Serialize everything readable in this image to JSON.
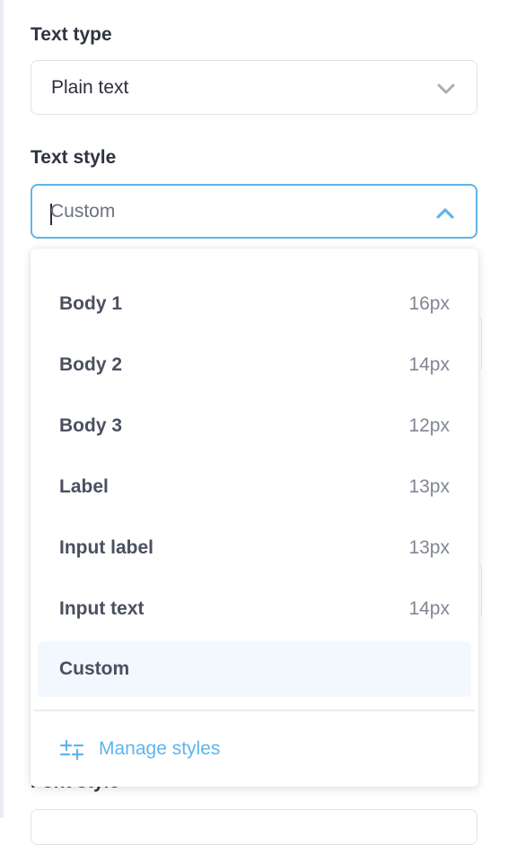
{
  "text_type": {
    "label": "Text type",
    "value": "Plain text",
    "chevron_icon": "chevron-down-icon"
  },
  "text_style": {
    "label": "Text style",
    "value": "Custom",
    "chevron_icon": "chevron-up-icon",
    "options": [
      {
        "name": "Body 1",
        "size": "16px"
      },
      {
        "name": "Body 2",
        "size": "14px"
      },
      {
        "name": "Body 3",
        "size": "12px"
      },
      {
        "name": "Label",
        "size": "13px"
      },
      {
        "name": "Input label",
        "size": "13px"
      },
      {
        "name": "Input text",
        "size": "14px"
      },
      {
        "name": "Custom",
        "size": ""
      }
    ],
    "selected_option": "Custom",
    "manage_label": "Manage styles",
    "manage_icon": "sliders-icon"
  },
  "background_label_partial": "Font style",
  "colors": {
    "accent": "#5fb4ec",
    "selected_bg": "#f2f8fd",
    "border": "#dfe3e8"
  }
}
